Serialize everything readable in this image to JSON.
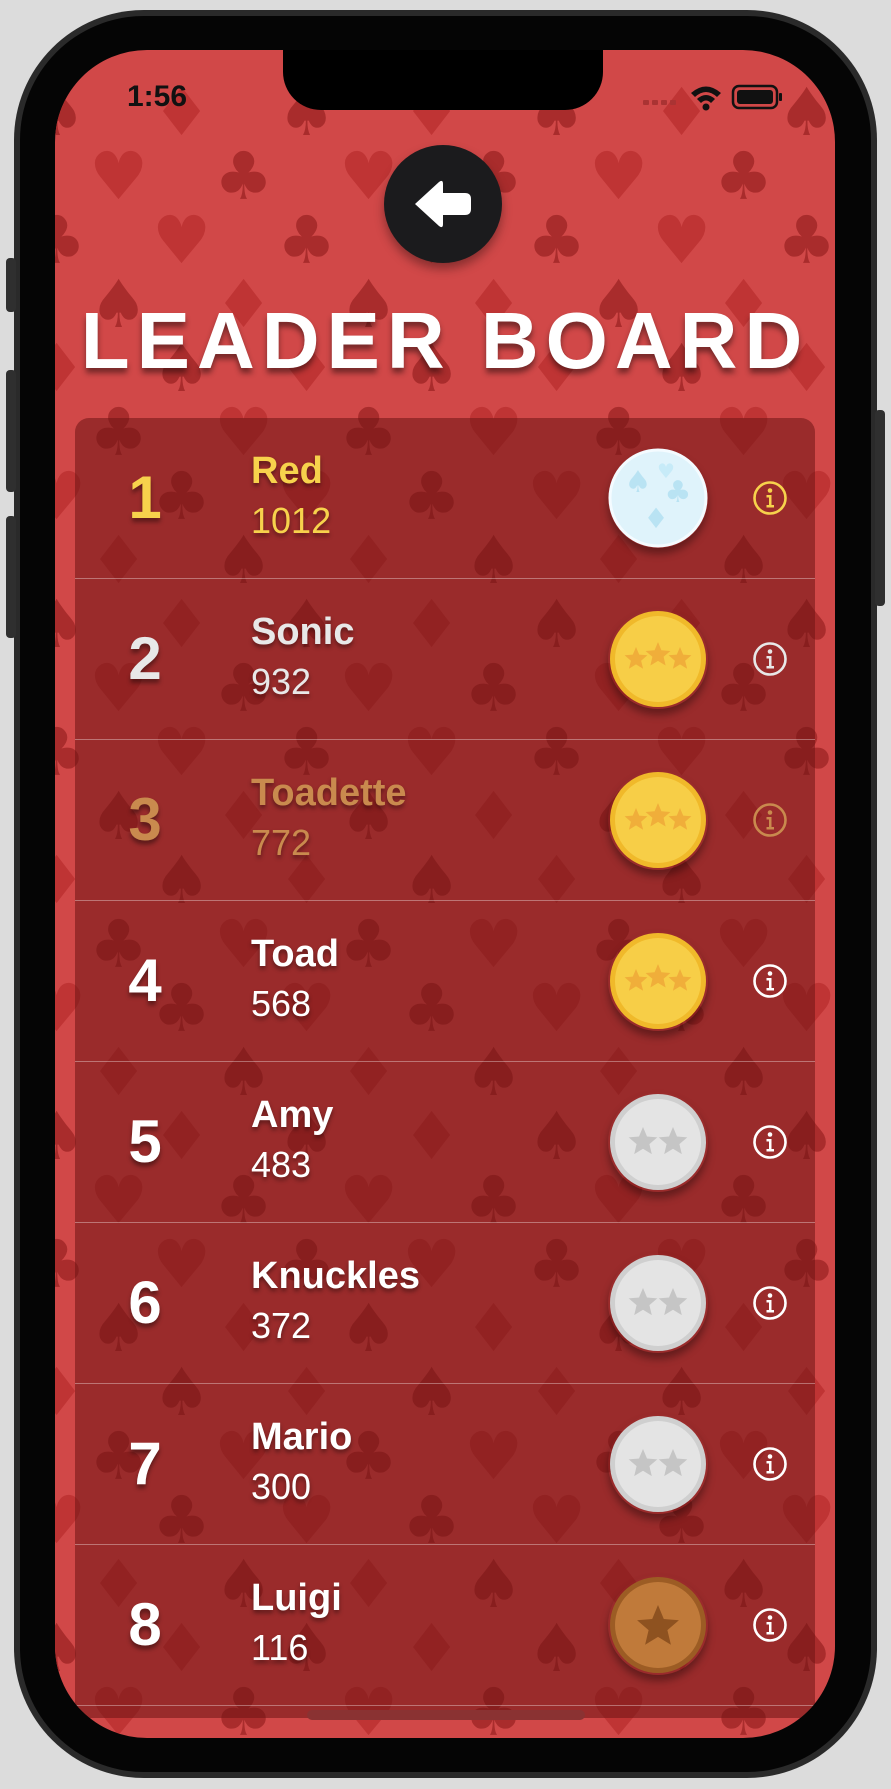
{
  "status_bar": {
    "time": "1:56"
  },
  "header": {
    "back_icon": "arrow-left-icon",
    "title": "LEADER BOARD"
  },
  "colors": {
    "background": "#d14848",
    "first_place": "#f7d24c",
    "second_place": "#e8e8e8",
    "third_place": "#c98a4e",
    "default_text": "#ffffff"
  },
  "leaderboard": [
    {
      "rank": "1",
      "name": "Red",
      "score": "1012",
      "medal": "diamond",
      "color": "#f7d24c"
    },
    {
      "rank": "2",
      "name": "Sonic",
      "score": "932",
      "medal": "gold-3-star",
      "color": "#e8e8e8"
    },
    {
      "rank": "3",
      "name": "Toadette",
      "score": "772",
      "medal": "gold-3-star",
      "color": "#c98a4e"
    },
    {
      "rank": "4",
      "name": "Toad",
      "score": "568",
      "medal": "gold-3-star",
      "color": "#ffffff"
    },
    {
      "rank": "5",
      "name": "Amy",
      "score": "483",
      "medal": "silver-2-star",
      "color": "#ffffff"
    },
    {
      "rank": "6",
      "name": "Knuckles",
      "score": "372",
      "medal": "silver-2-star",
      "color": "#ffffff"
    },
    {
      "rank": "7",
      "name": "Mario",
      "score": "300",
      "medal": "silver-2-star",
      "color": "#ffffff"
    },
    {
      "rank": "8",
      "name": "Luigi",
      "score": "116",
      "medal": "bronze-1-star",
      "color": "#ffffff"
    }
  ]
}
